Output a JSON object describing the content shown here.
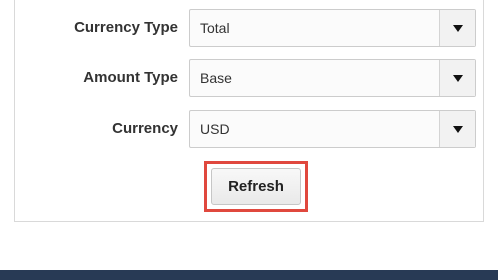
{
  "form": {
    "fields": [
      {
        "label": "Currency Type",
        "value": "Total"
      },
      {
        "label": "Amount Type",
        "value": "Base"
      },
      {
        "label": "Currency",
        "value": "USD"
      }
    ],
    "refresh_label": "Refresh"
  },
  "icons": {
    "dropdown": "chevron-down-icon"
  },
  "colors": {
    "highlight": "#e0483e",
    "footer_bar": "#283a55"
  }
}
